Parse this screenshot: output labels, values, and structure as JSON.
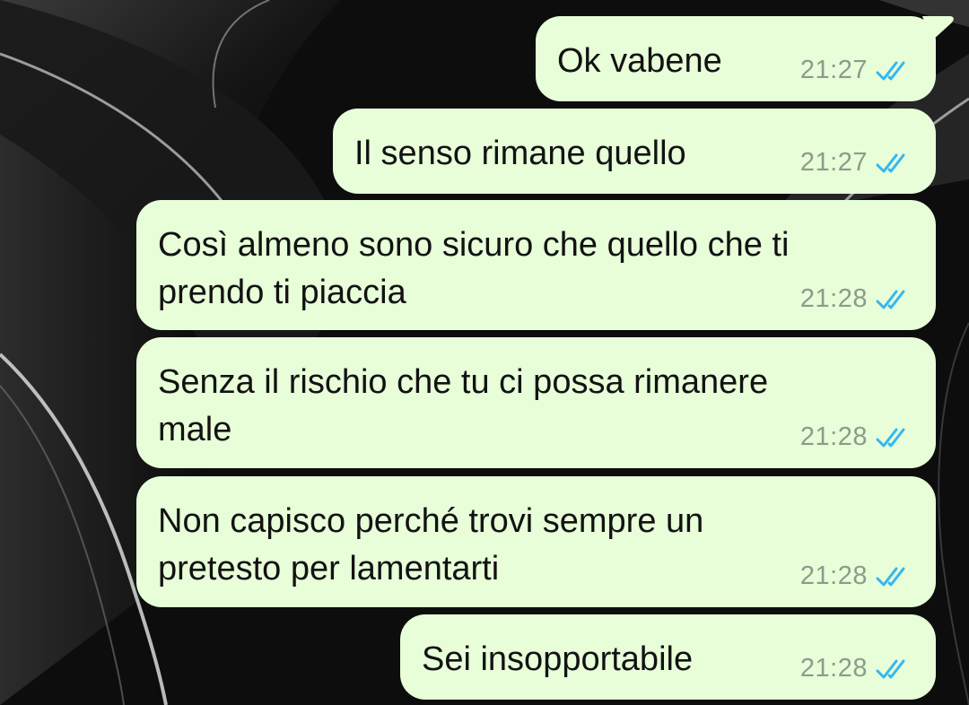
{
  "colors": {
    "bubble_background": "#e7fed9",
    "message_text": "#121212",
    "timestamp_text": "#8e9a8a",
    "read_ticks": "#34b7f1",
    "wallpaper": "#0b0b0b"
  },
  "wallpaper": {
    "icon": "dark-abstract-wave-wallpaper"
  },
  "messages": [
    {
      "text": "Ok vabene",
      "time": "21:27",
      "status": "read",
      "status_icon": "double-check-icon"
    },
    {
      "text": "Il senso rimane quello",
      "time": "21:27",
      "status": "read",
      "status_icon": "double-check-icon"
    },
    {
      "text": "Così almeno sono sicuro che quello che ti\nprendo ti piaccia",
      "time": "21:28",
      "status": "read",
      "status_icon": "double-check-icon"
    },
    {
      "text": "Senza il rischio che tu ci possa rimanere\nmale",
      "time": "21:28",
      "status": "read",
      "status_icon": "double-check-icon"
    },
    {
      "text": "Non capisco perché trovi sempre un\npretesto per lamentarti",
      "time": "21:28",
      "status": "read",
      "status_icon": "double-check-icon"
    },
    {
      "text": "Sei insopportabile",
      "time": "21:28",
      "status": "read",
      "status_icon": "double-check-icon"
    }
  ]
}
